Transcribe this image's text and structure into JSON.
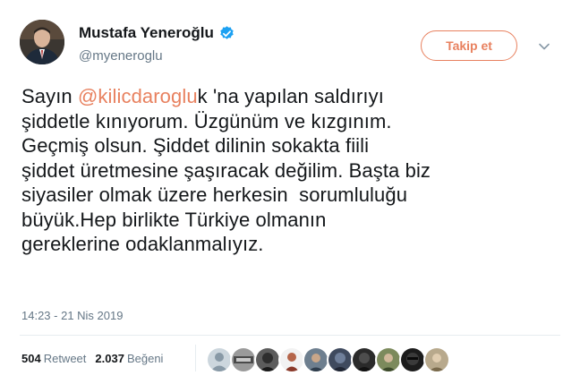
{
  "user": {
    "name": "Mustafa Yeneroğlu",
    "handle": "@myeneroglu"
  },
  "follow_button": {
    "label": "Takip et"
  },
  "tweet": {
    "text_before": "Sayın ",
    "mention": "@kilicdaroglu",
    "text_after": "k 'na yapılan saldırıyı\nşiddetle kınıyorum. Üzgünüm ve kızgınım.\nGeçmiş olsun. Şiddet dilinin sokakta fiili\nşiddet üretmesine şaşıracak değilim. Başta biz\nsiyasiler olmak üzere herkesin  sorumluluğu\nbüyük.Hep birlikte Türkiye olmanın\ngereklerine odaklanmalıyız.",
    "timestamp": "14:23 - 21 Nis 2019"
  },
  "stats": {
    "retweet_count": "504",
    "retweet_label": "Retweet",
    "like_count": "2.037",
    "like_label": "Beğeni"
  },
  "colors": {
    "accent": "#e8815f",
    "verified": "#1da1f2",
    "secondary_text": "#657786"
  },
  "likers": [
    "liker-avatar-1",
    "liker-avatar-2",
    "liker-avatar-3",
    "liker-avatar-4",
    "liker-avatar-5",
    "liker-avatar-6",
    "liker-avatar-7",
    "liker-avatar-8",
    "liker-avatar-9",
    "liker-avatar-10"
  ]
}
